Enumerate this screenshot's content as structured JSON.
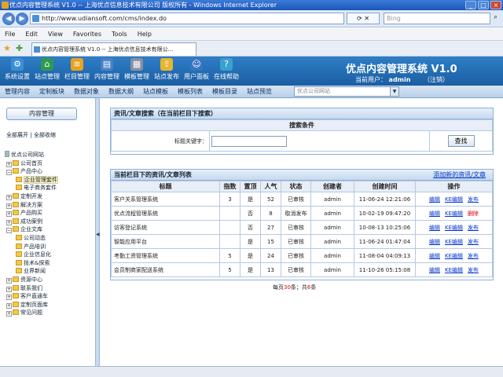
{
  "window": {
    "title": "优点内容管理系统 V1.0 -- 上海优点信息技术有限公司 版权所有 - Windows Internet Explorer",
    "controls": [
      "_",
      "□",
      "×"
    ]
  },
  "browser": {
    "url": "http://www.udiansoft.com/cms/index.do",
    "search_placeholder": "Bing",
    "menu": [
      "File",
      "Edit",
      "View",
      "Favorites",
      "Tools",
      "Help"
    ],
    "tab_title": "优点内容管理系统 V1.0 -- 上海优点信息技术有限公..."
  },
  "app": {
    "system_name": "优点内容管理系统 V1.0",
    "current_user_label": "当前用户：",
    "current_user": "admin",
    "logout": "（注销）",
    "top_icons": [
      {
        "label": "系统设置",
        "color": "#3a8fd6"
      },
      {
        "label": "站点管理",
        "color": "#2d9a52"
      },
      {
        "label": "栏目管理",
        "color": "#e8a220"
      },
      {
        "label": "内容管理",
        "color": "#4a7fc8"
      },
      {
        "label": "模板管理",
        "color": "#8a8fa0"
      },
      {
        "label": "站点发布",
        "color": "#e8b530"
      },
      {
        "label": "用户面板",
        "color": "#3a74c4"
      },
      {
        "label": "在线帮助",
        "color": "#3aa0d0"
      }
    ],
    "subnav": [
      "管理内容",
      "定制板块",
      "数据对象",
      "数据大纲",
      "站点模板",
      "模板列表",
      "模板目录",
      "站点预览"
    ],
    "site_select": "优点公司网站"
  },
  "left": {
    "button": "内容管理",
    "expand_all": "全部展开",
    "collapse_all": "全部收缩",
    "separator": "|",
    "tree": [
      {
        "label": "优点公司网站",
        "level": 0,
        "type": "root"
      },
      {
        "label": "公司首页",
        "level": 1,
        "type": "folder"
      },
      {
        "label": "产品中心",
        "level": 1,
        "type": "folder",
        "expanded": true
      },
      {
        "label": "企业管理套件",
        "level": 2,
        "type": "folder",
        "selected": true
      },
      {
        "label": "电子商务套件",
        "level": 2,
        "type": "folder"
      },
      {
        "label": "定制开发",
        "level": 1,
        "type": "folder"
      },
      {
        "label": "解决方案",
        "level": 1,
        "type": "folder"
      },
      {
        "label": "产品购买",
        "level": 1,
        "type": "folder"
      },
      {
        "label": "成功案例",
        "level": 1,
        "type": "folder"
      },
      {
        "label": "企业文库",
        "level": 1,
        "type": "folder",
        "expanded": true
      },
      {
        "label": "公司动态",
        "level": 2,
        "type": "folder"
      },
      {
        "label": "产品培训",
        "level": 2,
        "type": "folder"
      },
      {
        "label": "企业信息化",
        "level": 2,
        "type": "folder"
      },
      {
        "label": "技术&探索",
        "level": 2,
        "type": "folder"
      },
      {
        "label": "业界新闻",
        "level": 2,
        "type": "folder"
      },
      {
        "label": "资源中心",
        "level": 1,
        "type": "folder"
      },
      {
        "label": "联系我们",
        "level": 1,
        "type": "folder"
      },
      {
        "label": "客户直通车",
        "level": 1,
        "type": "folder"
      },
      {
        "label": "定制页面库",
        "level": 1,
        "type": "folder"
      },
      {
        "label": "常见问题",
        "level": 1,
        "type": "folder"
      }
    ]
  },
  "search_panel": {
    "title": "资讯/文章搜索（在当前栏目下搜索）",
    "condition_header": "搜索条件",
    "keyword_label": "标题关键字：",
    "keyword_value": "",
    "button": "查找"
  },
  "list_panel": {
    "title": "当前栏目下的资讯/文章列表",
    "add_link": "添加新的资讯/文章",
    "columns": [
      "标题",
      "指数",
      "置顶",
      "人气",
      "状态",
      "创建者",
      "创建时间",
      "操作"
    ],
    "rows": [
      {
        "title": "客户关系管理系统",
        "index": "3",
        "top": "是",
        "views": "52",
        "status": "已审核",
        "creator": "admin",
        "time": "11-06-24 12:21:06",
        "ops": [
          "编辑",
          "KE编辑",
          "发布"
        ]
      },
      {
        "title": "优点流程管理系统",
        "index": "",
        "top": "否",
        "views": "8",
        "status": "取消发布",
        "creator": "admin",
        "time": "10-02-19 09:47:20",
        "ops": [
          "编辑",
          "KE编辑",
          "删除"
        ]
      },
      {
        "title": "访客登记系统",
        "index": "",
        "top": "否",
        "views": "27",
        "status": "已审核",
        "creator": "admin",
        "time": "10-08-13 10:25:06",
        "ops": [
          "编辑",
          "KE编辑",
          "发布"
        ]
      },
      {
        "title": "智能应用平台",
        "index": "",
        "top": "是",
        "views": "15",
        "status": "已审核",
        "creator": "admin",
        "time": "11-06-24 01:47:04",
        "ops": [
          "编辑",
          "KE编辑",
          "发布"
        ]
      },
      {
        "title": "考勤工资管理系统",
        "index": "5",
        "top": "是",
        "views": "24",
        "status": "已审核",
        "creator": "admin",
        "time": "11-08-04 04:09:13",
        "ops": [
          "编辑",
          "KE编辑",
          "发布"
        ]
      },
      {
        "title": "会员制商家配送系统",
        "index": "5",
        "top": "是",
        "views": "13",
        "status": "已审核",
        "creator": "admin",
        "time": "11-10-26 05:15:08",
        "ops": [
          "编辑",
          "KE编辑",
          "发布"
        ]
      }
    ],
    "pager_prefix": "每页",
    "pager_per_page": "30",
    "pager_mid": "条；共",
    "pager_total": "6",
    "pager_suffix": "条"
  }
}
